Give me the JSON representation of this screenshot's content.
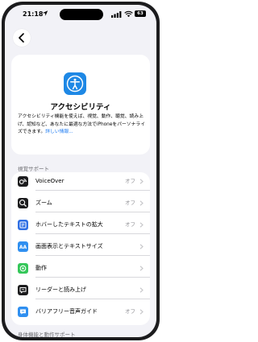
{
  "status": {
    "time": "21:18",
    "battery": "63"
  },
  "hero": {
    "title": "アクセシビリティ",
    "description": "アクセシビリティ機能を使えば、視覚、動作、聴覚、読み上げ、認知など、あなたに最適な方法でiPhoneをパーソナライズできます。",
    "link": "詳しい情報...",
    "accent": "#1e88e5"
  },
  "vision_section": {
    "header": "視覚サポート",
    "items": [
      {
        "label": "VoiceOver",
        "value": "オフ",
        "icon": "voiceover-icon",
        "color": "#1c1c1e"
      },
      {
        "label": "ズーム",
        "value": "オフ",
        "icon": "zoom-icon",
        "color": "#1c1c1e"
      },
      {
        "label": "ホバーしたテキストの拡大",
        "value": "オフ",
        "icon": "hover-text-icon",
        "color": "#2f6fe4"
      },
      {
        "label": "画面表示とテキストサイズ",
        "value": "",
        "icon": "text-size-icon",
        "color": "#2f8ff0"
      },
      {
        "label": "動作",
        "value": "",
        "icon": "motion-icon",
        "color": "#34c759"
      },
      {
        "label": "リーダーと読み上げ",
        "value": "",
        "icon": "spoken-content-icon",
        "color": "#1c1c1e"
      },
      {
        "label": "バリアフリー音声ガイド",
        "value": "オフ",
        "icon": "audio-description-icon",
        "color": "#2f8ff0"
      }
    ]
  },
  "physical_section": {
    "header": "身体機能と動作サポート"
  }
}
